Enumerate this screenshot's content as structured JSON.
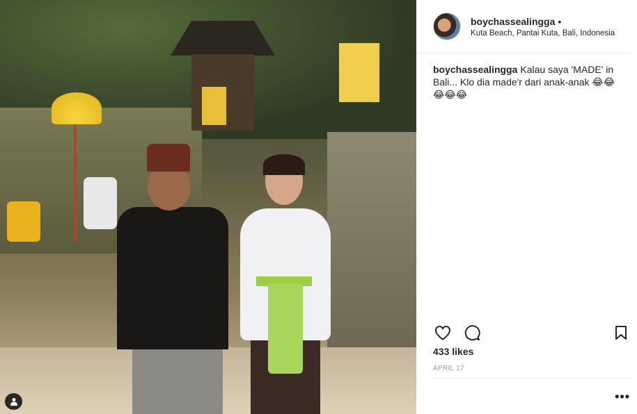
{
  "post": {
    "username": "boychassealingga",
    "separator": "•",
    "location": "Kuta Beach, Pantai Kuta, Bali, Indonesia",
    "caption_user": "boychassealingga",
    "caption_text": "Kalau saya 'MADE' in Bali... Klo dia made'r dari anak-anak 😂😂😂😂😂",
    "likes": "433 likes",
    "date": "APRIL 17",
    "more": "•••"
  },
  "icons": {
    "like": "heart-icon",
    "comment": "comment-icon",
    "save": "bookmark-icon",
    "tagged": "user-tag-icon",
    "options": "more-options-icon"
  },
  "colors": {
    "text": "#262626",
    "muted": "#999999",
    "divider": "#efefef"
  }
}
